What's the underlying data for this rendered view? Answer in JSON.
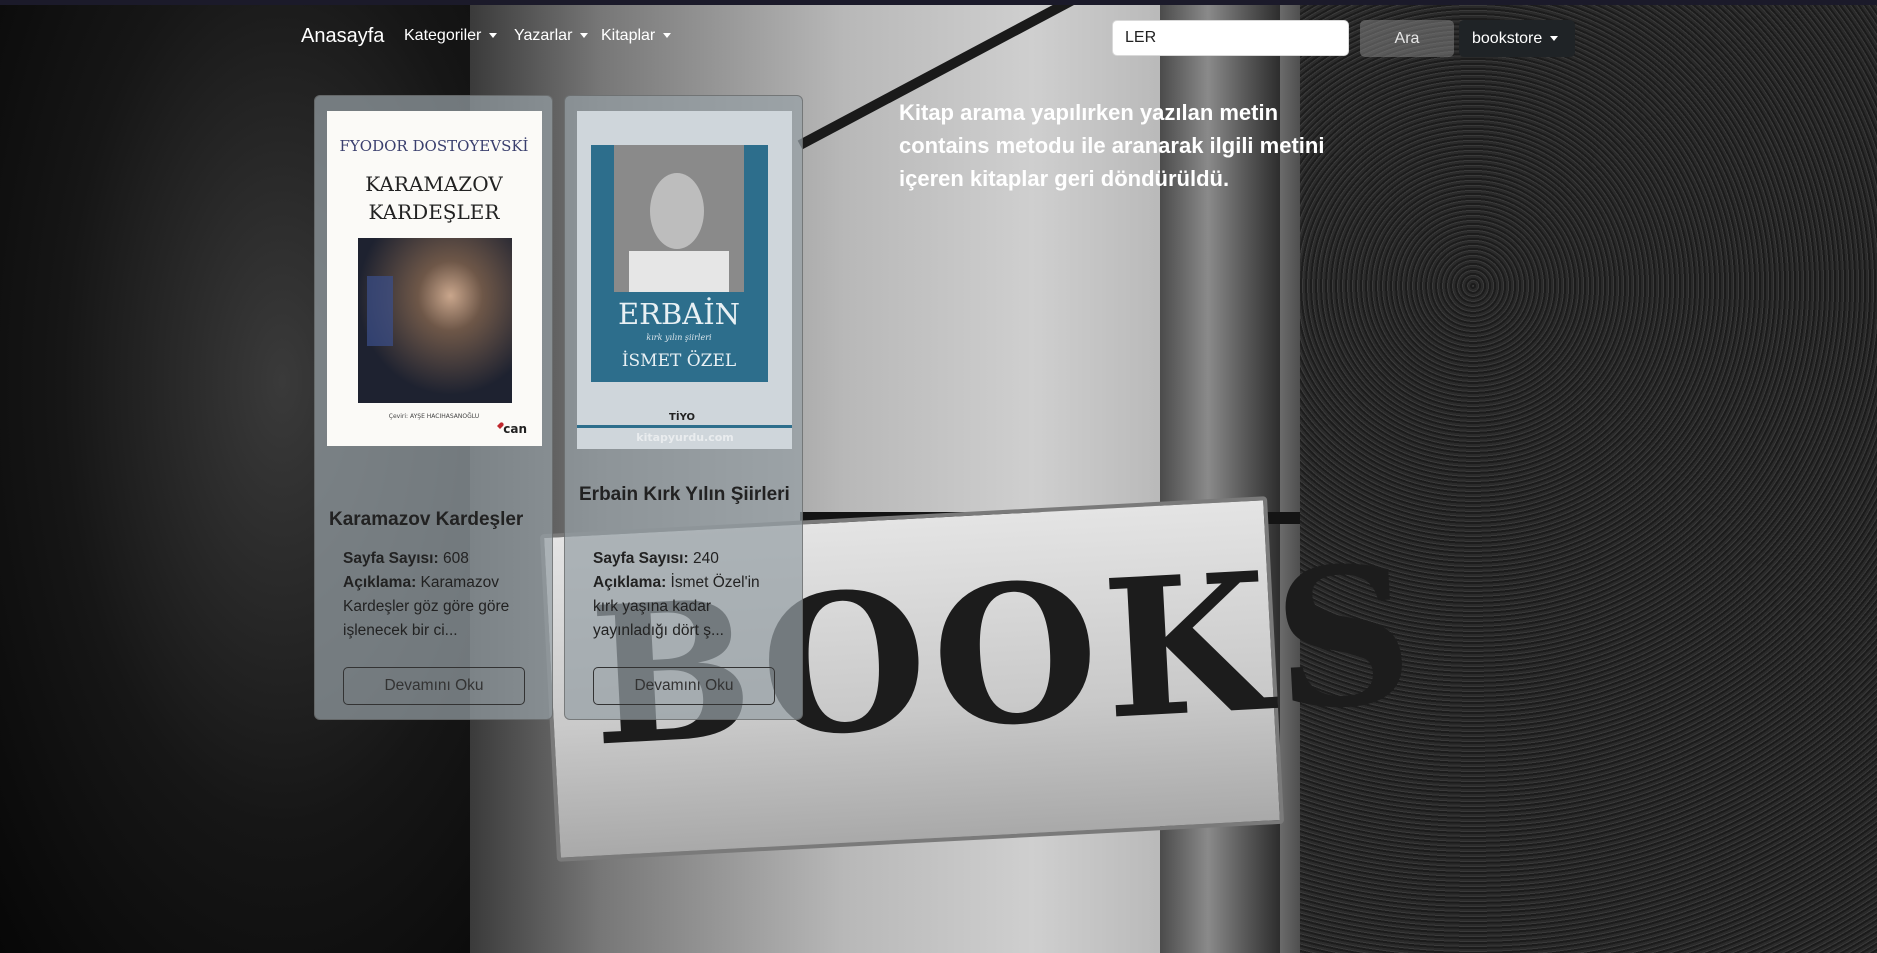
{
  "nav": {
    "brand": "Anasayfa",
    "items": [
      {
        "label": "Kategoriler"
      },
      {
        "label": "Yazarlar"
      },
      {
        "label": "Kitaplar"
      }
    ],
    "search_value": "LER",
    "search_button": "Ara",
    "user_menu": "bookstore"
  },
  "books": [
    {
      "title": "Karamazov Kardeşler",
      "pages_label": "Sayfa Sayısı:",
      "pages": "608",
      "desc_label": "Açıklama:",
      "desc": "Karamazov Kardeşler göz göre göre işlenecek bir ci...",
      "button": "Devamını Oku",
      "cover": {
        "author": "FYODOR DOSTOYEVSKİ",
        "title_line1": "KARAMAZOV",
        "title_line2": "KARDEŞLER",
        "translator": "Çeviri: AYŞE HACIHASANOĞLU",
        "publisher": "can"
      }
    },
    {
      "title": "Erbain Kırk Yılın Şiirleri",
      "pages_label": "Sayfa Sayısı:",
      "pages": "240",
      "desc_label": "Açıklama:",
      "desc": "İsmet Özel'in kırk yaşına kadar yayınladığı dört ş...",
      "button": "Devamını Oku",
      "cover": {
        "title": "ERBAİN",
        "subtitle": "kırk yılın şiirleri",
        "author": "İSMET ÖZEL",
        "publisher": "TİYO",
        "watermark": "kitapyurdu.com"
      }
    }
  ],
  "note": "Kitap arama yapılırken yazılan metin contains metodu ile aranarak ilgili metini içeren kitaplar geri döndürüldü.",
  "background": {
    "sign_text": "BOOKS"
  }
}
